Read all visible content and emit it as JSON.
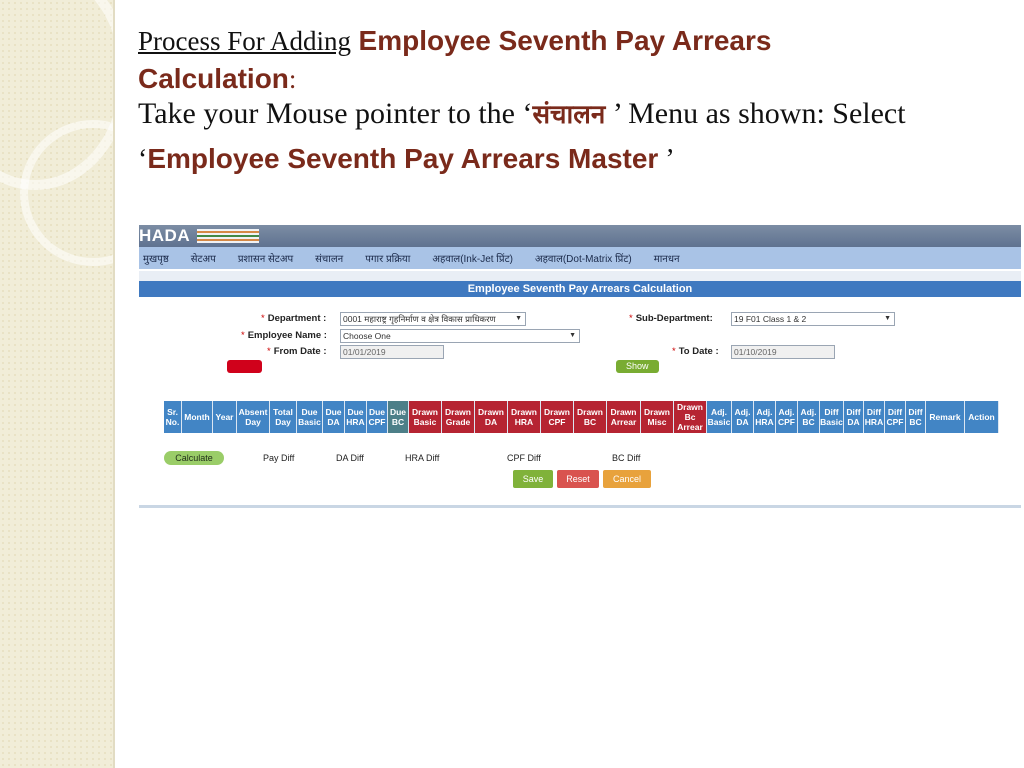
{
  "slide": {
    "line1_a": "Process For Adding",
    "line1_b": "Employee Seventh Pay Arrears",
    "line2": "Calculation",
    "line2_colon": ":",
    "line3_a": "Take your Mouse pointer to the ‘",
    "line3_hindi": "संचालन",
    "line3_b": " ’ Menu as shown: Select",
    "line4_q1": "‘",
    "line4_text": "Employee Seventh Pay Arrears Master",
    "line4_q2": " ’"
  },
  "app": {
    "logo": "HADA",
    "menu": [
      "मुखपृष्ठ",
      "सेटअप",
      "प्रशासन सेटअप",
      "संचालन",
      "पगार प्रक्रिया",
      "अहवाल(Ink-Jet प्रिंट)",
      "अहवाल(Dot-Matrix प्रिंट)",
      "मानधन"
    ],
    "page_title": "Employee Seventh Pay Arrears Calculation",
    "form": {
      "department_label": "Department :",
      "department_value": "0001 महाराष्ट्र गृहनिर्माण व क्षेत्र विकास प्राधिकरण",
      "sub_department_label": "Sub-Department:",
      "sub_department_value": "19 F01 Class 1 & 2",
      "employee_label": "Employee Name :",
      "employee_value": "Choose One",
      "from_date_label": "From Date :",
      "from_date_value": "01/01/2019",
      "to_date_label": "To Date :",
      "to_date_value": "01/10/2019",
      "show_button": "Show"
    },
    "columns": [
      {
        "label": "Sr. No.",
        "tone": "blue",
        "w": 18
      },
      {
        "label": "Month",
        "tone": "blue",
        "w": 31
      },
      {
        "label": "Year",
        "tone": "blue",
        "w": 24
      },
      {
        "label": "Absent Day",
        "tone": "blue",
        "w": 33
      },
      {
        "label": "Total Day",
        "tone": "blue",
        "w": 27
      },
      {
        "label": "Due Basic",
        "tone": "blue",
        "w": 26
      },
      {
        "label": "Due DA",
        "tone": "blue",
        "w": 22
      },
      {
        "label": "Due HRA",
        "tone": "blue",
        "w": 22
      },
      {
        "label": "Due CPF",
        "tone": "blue",
        "w": 21
      },
      {
        "label": "Due BC",
        "tone": "dark",
        "w": 21
      },
      {
        "label": "Drawn Basic",
        "tone": "red",
        "w": 33
      },
      {
        "label": "Drawn Grade",
        "tone": "red",
        "w": 33
      },
      {
        "label": "Drawn DA",
        "tone": "red",
        "w": 33
      },
      {
        "label": "Drawn HRA",
        "tone": "red",
        "w": 33
      },
      {
        "label": "Drawn CPF",
        "tone": "red",
        "w": 33
      },
      {
        "label": "Drawn BC",
        "tone": "red",
        "w": 33
      },
      {
        "label": "Drawn Arrear",
        "tone": "red",
        "w": 34
      },
      {
        "label": "Drawn Misc",
        "tone": "red",
        "w": 33
      },
      {
        "label": "Drawn Bc Arrear",
        "tone": "red",
        "w": 33
      },
      {
        "label": "Adj. Basic",
        "tone": "blue",
        "w": 25
      },
      {
        "label": "Adj. DA",
        "tone": "blue",
        "w": 22
      },
      {
        "label": "Adj. HRA",
        "tone": "blue",
        "w": 22
      },
      {
        "label": "Adj. CPF",
        "tone": "blue",
        "w": 22
      },
      {
        "label": "Adj. BC",
        "tone": "blue",
        "w": 22
      },
      {
        "label": "Diff Basic",
        "tone": "blue",
        "w": 24
      },
      {
        "label": "Diff DA",
        "tone": "blue",
        "w": 20
      },
      {
        "label": "Diff HRA",
        "tone": "blue",
        "w": 21
      },
      {
        "label": "Diff CPF",
        "tone": "blue",
        "w": 21
      },
      {
        "label": "Diff BC",
        "tone": "blue",
        "w": 20
      },
      {
        "label": "Remark",
        "tone": "blue",
        "w": 39
      },
      {
        "label": "Action",
        "tone": "blue",
        "w": 34
      }
    ],
    "calculate_button": "Calculate",
    "diffs": [
      "Pay Diff",
      "DA Diff",
      "HRA Diff",
      "CPF Diff",
      "BC Diff"
    ],
    "actions": {
      "save": "Save",
      "reset": "Reset",
      "cancel": "Cancel"
    }
  },
  "colors": {
    "title_brown": "#7a2a1b",
    "header_blue": "#3f79c0",
    "grid_blue": "#4285c5",
    "grid_red": "#b62432"
  }
}
